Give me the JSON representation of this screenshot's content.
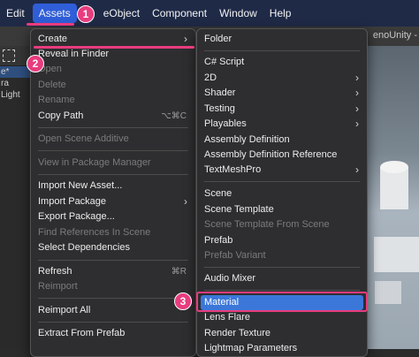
{
  "menubar": {
    "items": [
      "Edit",
      "Assets",
      "GameObject",
      "Component",
      "Window",
      "Help"
    ],
    "gameobject_visible": "eObject"
  },
  "window_title_partial": "enoUnity -",
  "hierarchy": {
    "rows": [
      "e*",
      "ra",
      "Light"
    ]
  },
  "assets_menu": {
    "items": [
      {
        "label": "Create",
        "state": "normal",
        "submenu": true
      },
      {
        "label": "Reveal in Finder",
        "state": "normal"
      },
      {
        "label": "Open",
        "state": "disabled"
      },
      {
        "label": "Delete",
        "state": "disabled"
      },
      {
        "label": "Rename",
        "state": "disabled"
      },
      {
        "label": "Copy Path",
        "state": "normal",
        "shortcut": "⌥⌘C"
      },
      {
        "label": "Open Scene Additive",
        "state": "disabled"
      },
      {
        "label": "View in Package Manager",
        "state": "disabled"
      },
      {
        "label": "Import New Asset...",
        "state": "normal"
      },
      {
        "label": "Import Package",
        "state": "normal",
        "submenu": true
      },
      {
        "label": "Export Package...",
        "state": "normal"
      },
      {
        "label": "Find References In Scene",
        "state": "disabled"
      },
      {
        "label": "Select Dependencies",
        "state": "normal"
      },
      {
        "label": "Refresh",
        "state": "normal",
        "shortcut": "⌘R"
      },
      {
        "label": "Reimport",
        "state": "disabled"
      },
      {
        "label": "Reimport All",
        "state": "normal"
      },
      {
        "label": "Extract From Prefab",
        "state": "normal"
      }
    ]
  },
  "create_submenu": {
    "items": [
      {
        "label": "Folder",
        "state": "normal"
      },
      {
        "label": "C# Script",
        "state": "normal"
      },
      {
        "label": "2D",
        "state": "normal",
        "submenu": true
      },
      {
        "label": "Shader",
        "state": "normal",
        "submenu": true
      },
      {
        "label": "Testing",
        "state": "normal",
        "submenu": true
      },
      {
        "label": "Playables",
        "state": "normal",
        "submenu": true
      },
      {
        "label": "Assembly Definition",
        "state": "normal"
      },
      {
        "label": "Assembly Definition Reference",
        "state": "normal"
      },
      {
        "label": "TextMeshPro",
        "state": "normal",
        "submenu": true
      },
      {
        "label": "Scene",
        "state": "normal"
      },
      {
        "label": "Scene Template",
        "state": "normal"
      },
      {
        "label": "Scene Template From Scene",
        "state": "disabled"
      },
      {
        "label": "Prefab",
        "state": "normal"
      },
      {
        "label": "Prefab Variant",
        "state": "disabled"
      },
      {
        "label": "Audio Mixer",
        "state": "normal"
      },
      {
        "label": "Material",
        "state": "highlighted"
      },
      {
        "label": "Lens Flare",
        "state": "normal"
      },
      {
        "label": "Render Texture",
        "state": "normal"
      },
      {
        "label": "Lightmap Parameters",
        "state": "normal"
      }
    ]
  },
  "annotations": {
    "step1": "1",
    "step2": "2",
    "step3": "3"
  },
  "colors": {
    "accent": "#e83c7e",
    "highlight": "#3b77d9",
    "menubar": "#1f2a47"
  }
}
